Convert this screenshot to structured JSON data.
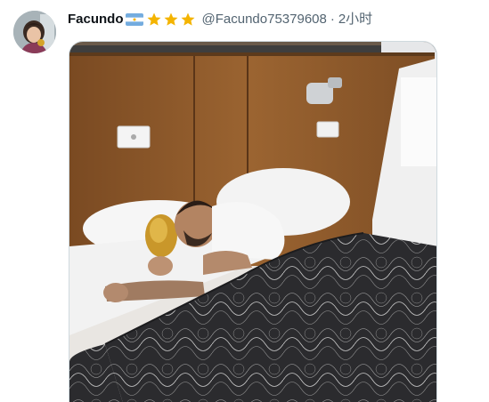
{
  "tweet": {
    "display_name": "Facundo",
    "handle": "@Facundo75379608",
    "separator": "·",
    "time": "2小时",
    "flag_emoji": "argentina-flag",
    "star_count": 3,
    "star_color": "#f4b400",
    "media": {
      "kind": "photo"
    }
  },
  "colors": {
    "text_primary": "#0f1419",
    "text_secondary": "#536471",
    "border": "#cfd9de"
  }
}
